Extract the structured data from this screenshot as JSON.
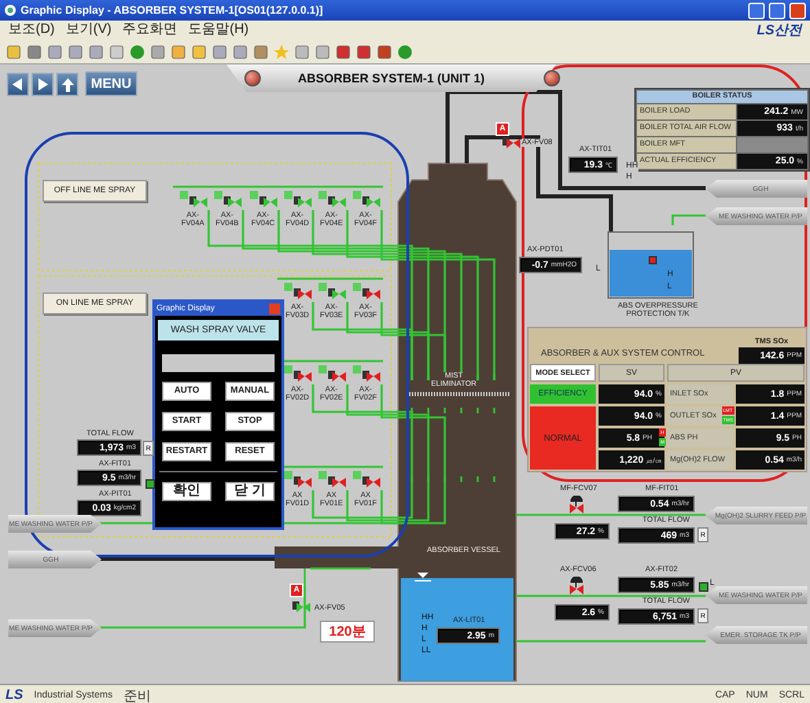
{
  "window": {
    "title": "Graphic Display - ABSORBER SYSTEM-1[OS01(127.0.0.1)]"
  },
  "menu": [
    "보조(D)",
    "보기(V)",
    "주요화면",
    "도움말(H)"
  ],
  "brand": "LS산전",
  "nav": {
    "menu_button": "MENU"
  },
  "header": {
    "title": "ABSORBER SYSTEM-1 (UNIT 1)"
  },
  "boiler_status": {
    "title": "BOILER STATUS",
    "rows": [
      {
        "label": "BOILER LOAD",
        "value": "241.2",
        "unit": "MW"
      },
      {
        "label": "BOILER TOTAL AIR FLOW",
        "value": "933",
        "unit": "t/h"
      },
      {
        "label": "BOILER MFT"
      },
      {
        "label": "ACTUAL EFFICIENCY",
        "value": "25.0",
        "unit": "%"
      }
    ]
  },
  "spray_buttons": [
    "OFF LINE ME SPRAY",
    "ON LINE ME SPRAY"
  ],
  "valve_rows": [
    {
      "valves": [
        {
          "label": "AX-\nFV04A",
          "open": true
        },
        {
          "label": "AX-\nFV04B",
          "open": true
        },
        {
          "label": "AX-\nFV04C",
          "open": true
        },
        {
          "label": "AX-\nFV04D",
          "open": true
        },
        {
          "label": "AX-\nFV04E",
          "open": true
        },
        {
          "label": "AX-\nFV04F",
          "open": true
        }
      ]
    },
    {
      "valves": [
        {
          "label": "AX-\nFV03D",
          "open": false
        },
        {
          "label": "AX-\nFV03E",
          "open": true
        },
        {
          "label": "AX-\nFV03F",
          "open": false
        }
      ]
    },
    {
      "valves": [
        {
          "label": "AX-\nFV02D",
          "open": false
        },
        {
          "label": "AX-\nFV02E",
          "open": false
        },
        {
          "label": "AX-\nFV02F",
          "open": false
        }
      ]
    },
    {
      "valves": [
        {
          "label": "AX\nFV01D",
          "open": false
        },
        {
          "label": "AX\nFV01E",
          "open": false
        },
        {
          "label": "AX\nFV01F",
          "open": false
        }
      ]
    }
  ],
  "dialog": {
    "title": "Graphic Display",
    "header": "WASH SPRAY VALVE",
    "buttons": [
      "AUTO",
      "MANUAL",
      "START",
      "STOP",
      "RESTART",
      "RESET"
    ],
    "footer_buttons": [
      "확인",
      "닫 기"
    ]
  },
  "left_meters": [
    {
      "label": "TOTAL FLOW",
      "value": "1,973",
      "unit": "m3",
      "reset": "R"
    },
    {
      "label": "AX-FIT01",
      "value": "9.5",
      "unit": "m3/hr"
    },
    {
      "label": "AX-PIT01",
      "value": "0.03",
      "unit": "kg/cm2"
    }
  ],
  "left_lines": [
    {
      "label": "ME WASHING WATER P/P",
      "kind": "water"
    },
    {
      "label": "GGH",
      "kind": "gas"
    },
    {
      "label": "ME WASHING WATER P/P",
      "kind": "water"
    }
  ],
  "fv05": {
    "alarm": "A",
    "label": "AX-FV05",
    "timer": "120분"
  },
  "tower": {
    "upper": "MIST\nELIMINATOR",
    "lower": "ABSORBER VESSEL",
    "level_tag": "AX-LIT01",
    "level_value": "2.95",
    "level_unit": "m",
    "marks": [
      "HH",
      "H",
      "L",
      "LL"
    ]
  },
  "top_right": {
    "fv08_alarm": "A",
    "fv08": "AX-FV08",
    "tit": "AX-TIT01",
    "tit_value": "19.3",
    "tit_unit": "℃",
    "tit_marks": [
      "HH",
      "H"
    ],
    "pdt": "AX-PDT01",
    "pdt_value": "-0.7",
    "pdt_unit": "mmH2O",
    "pdt_mark": "L",
    "tank_marks": [
      "H",
      "L"
    ],
    "tank_label": "ABS OVERPRESSURE\nPROTECTION T/K"
  },
  "right_lines": [
    {
      "label": "GGH",
      "kind": "gas"
    },
    {
      "label": "ME WASHING WATER P/P",
      "kind": "water"
    },
    {
      "label": "Mg(OH)2 SLURRY FEED P/P",
      "kind": "water"
    },
    {
      "label": "ME WASHING WATER P/P",
      "kind": "water"
    },
    {
      "label": "EMER. STORAGE TK P/P",
      "kind": "water"
    }
  ],
  "control": {
    "title": "ABSORBER & AUX SYSTEM CONTROL",
    "tms_label": "TMS SOx",
    "tms_value": "142.6",
    "tms_unit": "PPM",
    "mode_select": "MODE SELECT",
    "sv": "SV",
    "pv": "PV",
    "efficiency": "EFFICIENCY",
    "status": "NORMAL",
    "rows": [
      {
        "sv": "94.0",
        "sv_unit": "%",
        "name": "INLET SOx",
        "pv": "1.8",
        "pv_unit": "PPM"
      },
      {
        "sv": "94.0",
        "sv_unit": "%",
        "name": "OUTLET SOx",
        "tags": [
          {
            "text": "LMT",
            "color": "#e02020"
          },
          {
            "text": "TMS",
            "color": "#30c030"
          }
        ],
        "pv": "1.4",
        "pv_unit": "PPM"
      },
      {
        "sv": "5.8",
        "sv_unit": "PH",
        "tags": [
          {
            "text": "H",
            "color": "#e02020"
          },
          {
            "text": "M",
            "color": "#30c030"
          }
        ],
        "name": "ABS PH",
        "pv": "9.5",
        "pv_unit": "PH"
      },
      {
        "sv": "1,220",
        "sv_unit": "㎲/㎝",
        "name": "Mg(OH)2 FLOW",
        "pv": "0.54",
        "pv_unit": "m3/h"
      }
    ]
  },
  "feeds": [
    {
      "valve": "MF-FCV07",
      "open": false,
      "percent": "27.2",
      "percent_unit": "%",
      "meter": "MF-FIT01",
      "flow": "0.54",
      "flow_unit": "m3/hr",
      "total_label": "TOTAL FLOW",
      "total": "469",
      "total_unit": "m3",
      "reset": "R"
    },
    {
      "valve": "AX-FCV06",
      "open": false,
      "percent": "2.6",
      "percent_unit": "%",
      "meter": "AX-FIT02",
      "flow": "5.85",
      "flow_unit": "m3/hr",
      "flow_mark": "L",
      "total_label": "TOTAL FLOW",
      "total": "6,751",
      "total_unit": "m3",
      "reset": "R"
    }
  ],
  "status_bar": {
    "logo": "LS",
    "logo_sub": "Industrial Systems",
    "status": "준비",
    "indicators": [
      "CAP",
      "NUM",
      "SCRL"
    ]
  }
}
